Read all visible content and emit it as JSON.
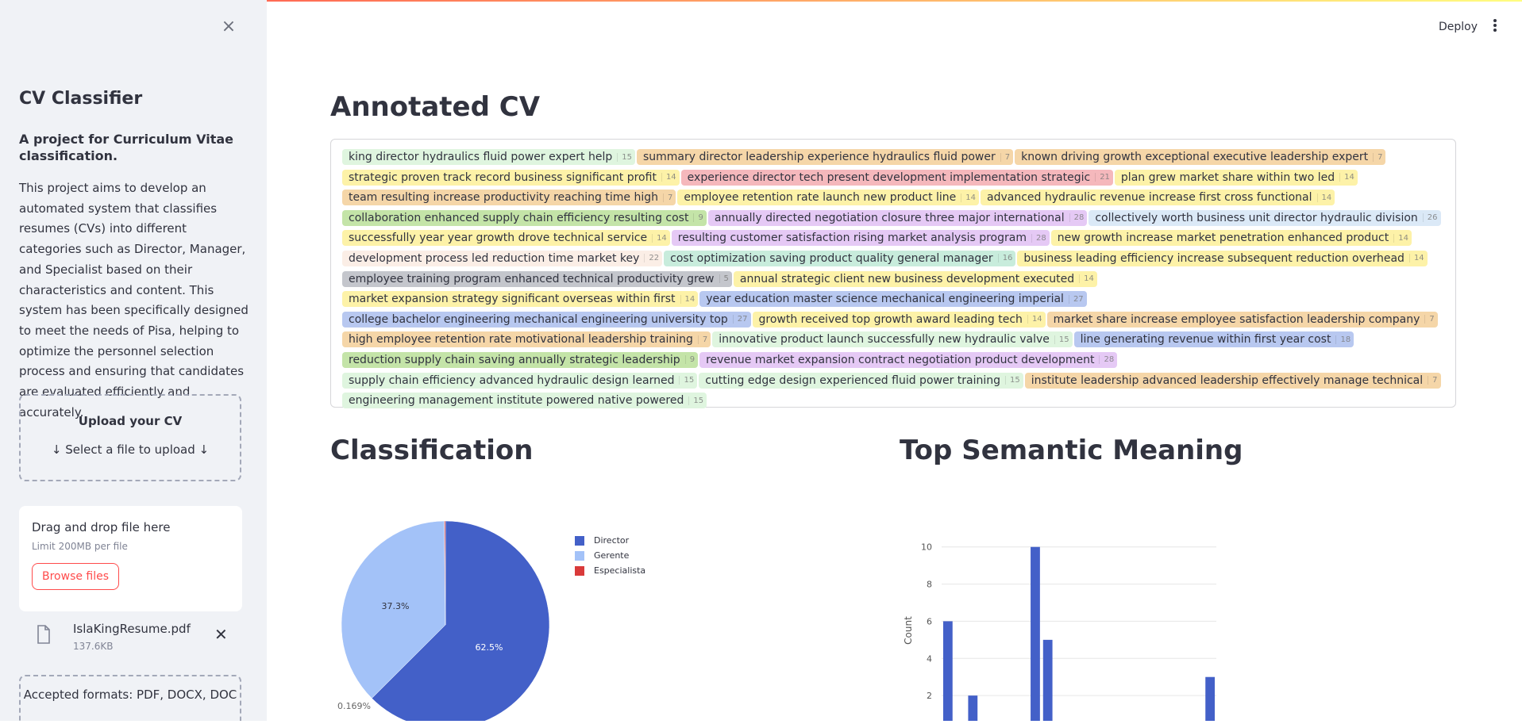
{
  "header": {
    "deploy_label": "Deploy"
  },
  "sidebar": {
    "title": "CV Classifier",
    "subtitle": "A project for Curriculum Vitae classification.",
    "description": "This project aims to develop an automated system that classifies resumes (CVs) into different categories such as Director, Manager, and Specialist based on their characteristics and content. This system has been specifically designed to meet the needs of Pisa, helping to optimize the personnel selection process and ensuring that candidates are evaluated efficiently and accurately.",
    "upload_title": "Upload your CV",
    "upload_hint": "↓ Select a file to upload ↓",
    "drop_title": "Drag and drop file here",
    "drop_limit": "Limit 200MB per file",
    "browse_label": "Browse files",
    "file_name": "IslaKingResume.pdf",
    "file_size": "137.6KB",
    "formats": "Accepted formats: PDF, DOCX, DOC"
  },
  "main": {
    "annotated_title": "Annotated CV",
    "classification_title": "Classification",
    "semantic_title": "Top Semantic Meaning"
  },
  "chips": [
    {
      "text": "king director hydraulics fluid power expert help",
      "tag": "15",
      "color": "#dff5df"
    },
    {
      "text": "summary director leadership experience hydraulics fluid power",
      "tag": "7",
      "color": "#f5d6a8"
    },
    {
      "text": "known driving growth exceptional executive leadership expert",
      "tag": "7",
      "color": "#f5d6a8"
    },
    {
      "text": "strategic proven track record business significant profit",
      "tag": "14",
      "color": "#fdf2a8"
    },
    {
      "text": "experience director tech present development implementation strategic",
      "tag": "21",
      "color": "#f5b8bc"
    },
    {
      "text": "plan grew market share within two led",
      "tag": "14",
      "color": "#fdf2a8"
    },
    {
      "text": "team resulting increase productivity reaching time high",
      "tag": "7",
      "color": "#f5d6a8"
    },
    {
      "text": "employee retention rate launch new product line",
      "tag": "14",
      "color": "#fdf2a8"
    },
    {
      "text": "advanced hydraulic revenue increase first cross functional",
      "tag": "14",
      "color": "#fdf2a8"
    },
    {
      "text": "collaboration enhanced supply chain efficiency resulting cost",
      "tag": "9",
      "color": "#c4e4a8"
    },
    {
      "text": "annually directed negotiation closure three major international",
      "tag": "28",
      "color": "#e5c9f5"
    },
    {
      "text": "collectively worth business unit director hydraulic division",
      "tag": "26",
      "color": "#dbe9f7"
    },
    {
      "text": "successfully year year growth drove technical service",
      "tag": "14",
      "color": "#fdf2a8"
    },
    {
      "text": "resulting customer satisfaction rising market analysis program",
      "tag": "28",
      "color": "#e5c9f5"
    },
    {
      "text": "new growth increase market penetration enhanced product",
      "tag": "14",
      "color": "#fdf2a8"
    },
    {
      "text": "development process led reduction time market key",
      "tag": "22",
      "color": "#fbeee6"
    },
    {
      "text": "cost optimization saving product quality general manager",
      "tag": "16",
      "color": "#c8ecdc"
    },
    {
      "text": "business leading efficiency increase subsequent reduction overhead",
      "tag": "14",
      "color": "#fdf2a8"
    },
    {
      "text": "employee training program enhanced technical productivity grew",
      "tag": "5",
      "color": "#c4c6cc"
    },
    {
      "text": "annual strategic client new business development executed",
      "tag": "14",
      "color": "#fdf2a8"
    },
    {
      "text": "market expansion strategy significant overseas within first",
      "tag": "14",
      "color": "#fdf2a8"
    },
    {
      "text": "year education master science mechanical engineering imperial",
      "tag": "27",
      "color": "#b8c8f0"
    },
    {
      "text": "college bachelor engineering mechanical engineering university top",
      "tag": "27",
      "color": "#b8c8f0"
    },
    {
      "text": "growth received top growth award leading tech",
      "tag": "14",
      "color": "#fdf2a8"
    },
    {
      "text": "market share increase employee satisfaction leadership company",
      "tag": "7",
      "color": "#f5d6a8"
    },
    {
      "text": "high employee retention rate motivational leadership training",
      "tag": "7",
      "color": "#f5d6a8"
    },
    {
      "text": "innovative product launch successfully new hydraulic valve",
      "tag": "15",
      "color": "#dff5df"
    },
    {
      "text": "line generating revenue within first year cost",
      "tag": "18",
      "color": "#b8c8f0"
    },
    {
      "text": "reduction supply chain saving annually strategic leadership",
      "tag": "9",
      "color": "#c4e4a8"
    },
    {
      "text": "revenue market expansion contract negotiation product development",
      "tag": "28",
      "color": "#e5c9f5"
    },
    {
      "text": "supply chain efficiency advanced hydraulic design learned",
      "tag": "15",
      "color": "#dff5df"
    },
    {
      "text": "cutting edge design experienced fluid power training",
      "tag": "15",
      "color": "#dff5df"
    },
    {
      "text": "institute leadership advanced leadership effectively manage technical",
      "tag": "7",
      "color": "#f5d6a8"
    },
    {
      "text": "engineering management institute powered native powered",
      "tag": "15",
      "color": "#dff5df"
    }
  ],
  "chart_data": [
    {
      "type": "pie",
      "labels": [
        "Director",
        "Gerente",
        "Especialista"
      ],
      "values": [
        62.5,
        37.3,
        0.169
      ],
      "value_labels": [
        "62.5%",
        "37.3%",
        "0.169%"
      ],
      "colors": [
        "#4360c8",
        "#a3c2f8",
        "#d93a3a"
      ],
      "legend": "right"
    },
    {
      "type": "bar",
      "x": [
        0,
        2,
        7,
        8,
        21
      ],
      "values": [
        6,
        2,
        10,
        5,
        3
      ],
      "ylabel": "Count",
      "yticks": [
        2,
        4,
        6,
        8,
        10
      ],
      "ylim": [
        0,
        10.5
      ],
      "xlim": [
        -0.5,
        21.5
      ],
      "color": "#4360c8"
    }
  ]
}
